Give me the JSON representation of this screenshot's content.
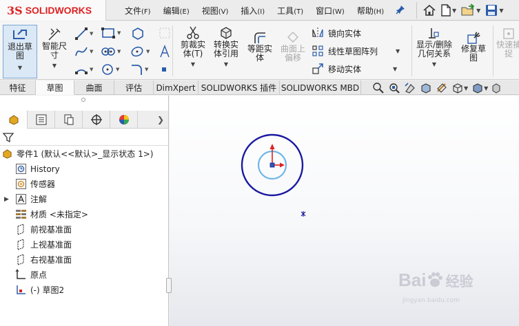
{
  "app": {
    "brand": "SOLIDWORKS",
    "brand_mark": "3S"
  },
  "menu": [
    {
      "label": "文件",
      "accel": "(F)"
    },
    {
      "label": "编辑",
      "accel": "(E)"
    },
    {
      "label": "视图",
      "accel": "(V)"
    },
    {
      "label": "插入",
      "accel": "(I)"
    },
    {
      "label": "工具",
      "accel": "(T)"
    },
    {
      "label": "窗口",
      "accel": "(W)"
    },
    {
      "label": "帮助",
      "accel": "(H)"
    }
  ],
  "ribbon": {
    "exit_sketch": "退出草\n图",
    "smart_dim": "智能尺\n寸",
    "trim": "剪裁实\n体(T)",
    "convert": "转换实\n体引用",
    "offset": "等距实\n体",
    "surface_offset": "曲面上\n偏移",
    "mirror": "镜向实体",
    "linear_pattern": "线性草图阵列",
    "move": "移动实体",
    "show_relations": "显示/删除\n几何关系",
    "repair": "修复草\n图",
    "quick_snap": "快速捕\n捉"
  },
  "tabs": [
    {
      "label": "特征",
      "active": false
    },
    {
      "label": "草图",
      "active": true
    },
    {
      "label": "曲面",
      "active": false
    },
    {
      "label": "评估",
      "active": false
    },
    {
      "label": "DimXpert",
      "active": false
    },
    {
      "label": "SOLIDWORKS 插件",
      "active": false
    },
    {
      "label": "SOLIDWORKS MBD",
      "active": false
    }
  ],
  "tree": {
    "root": "零件1  (默认<<默认>_显示状态 1>)",
    "items": [
      {
        "label": "History",
        "icon": "history-icon"
      },
      {
        "label": "传感器",
        "icon": "sensor-icon"
      },
      {
        "label": "注解",
        "icon": "annotation-icon"
      },
      {
        "label": "材质 <未指定>",
        "icon": "material-icon"
      },
      {
        "label": "前视基准面",
        "icon": "plane-icon"
      },
      {
        "label": "上视基准面",
        "icon": "plane-icon"
      },
      {
        "label": "右视基准面",
        "icon": "plane-icon"
      },
      {
        "label": "原点",
        "icon": "origin-icon"
      },
      {
        "label": "(-) 草图2",
        "icon": "sketch-icon"
      }
    ]
  },
  "watermark": {
    "brand": "Bai",
    "brand2": "经验",
    "url": "jingyan.baidu.com"
  },
  "colors": {
    "outer_circle": "#1a1aa0",
    "inner_circle": "#6fb6e6",
    "accent": "#2a5caa",
    "brand_red": "#d22222"
  }
}
